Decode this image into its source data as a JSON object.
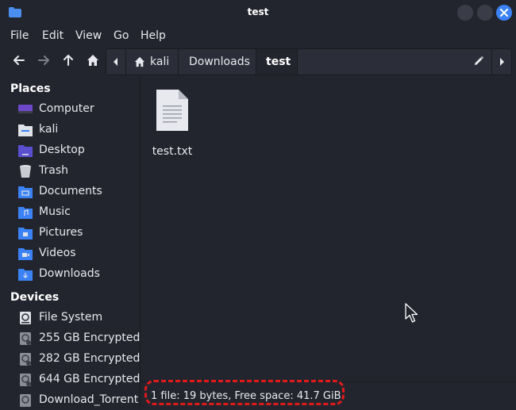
{
  "window": {
    "title": "test"
  },
  "menu": [
    "File",
    "Edit",
    "View",
    "Go",
    "Help"
  ],
  "path": {
    "crumbs": [
      "kali",
      "Downloads",
      "test"
    ]
  },
  "sidebar": {
    "places_title": "Places",
    "places": [
      {
        "label": "Computer",
        "icon": "computer-icon"
      },
      {
        "label": "kali",
        "icon": "home-folder-icon"
      },
      {
        "label": "Desktop",
        "icon": "desktop-folder-icon"
      },
      {
        "label": "Trash",
        "icon": "trash-icon"
      },
      {
        "label": "Documents",
        "icon": "documents-folder-icon"
      },
      {
        "label": "Music",
        "icon": "music-folder-icon"
      },
      {
        "label": "Pictures",
        "icon": "pictures-folder-icon"
      },
      {
        "label": "Videos",
        "icon": "videos-folder-icon"
      },
      {
        "label": "Downloads",
        "icon": "downloads-folder-icon"
      }
    ],
    "devices_title": "Devices",
    "devices": [
      {
        "label": "File System",
        "icon": "drive-icon"
      },
      {
        "label": "255 GB Encrypted",
        "icon": "encrypted-drive-icon"
      },
      {
        "label": "282 GB Encrypted",
        "icon": "encrypted-drive-icon"
      },
      {
        "label": "644 GB Encrypted",
        "icon": "encrypted-drive-icon"
      },
      {
        "label": "Download_Torrent",
        "icon": "drive-icon"
      }
    ]
  },
  "files": [
    {
      "name": "test.txt",
      "icon": "text-file-icon"
    }
  ],
  "status": {
    "text": "1 file: 19 bytes, Free space: 41.7 GiB"
  },
  "colors": {
    "accent": "#3b82f6",
    "highlight": "#e01a1a",
    "background": "#23252e"
  }
}
